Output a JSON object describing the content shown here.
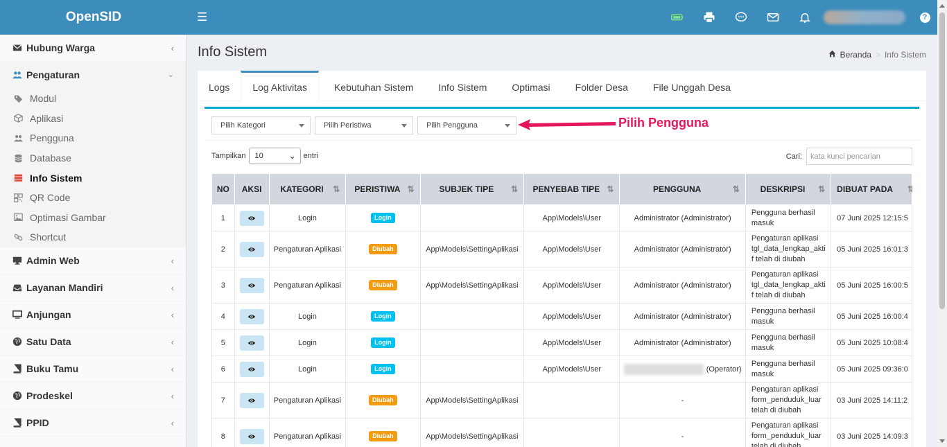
{
  "app": {
    "title": "OpenSID"
  },
  "header": {
    "icons": [
      "battery-icon",
      "print-icon",
      "chat-icon",
      "mail-icon",
      "bell-icon"
    ],
    "help_label": "?"
  },
  "sidebar": {
    "groups": [
      {
        "label": "Hubung Warga",
        "icon": "envelope-icon"
      },
      {
        "label": "Pengaturan",
        "icon": "users-icon"
      },
      {
        "label": "Admin Web",
        "icon": "desktop-icon"
      },
      {
        "label": "Layanan Mandiri",
        "icon": "inbox-icon"
      },
      {
        "label": "Anjungan",
        "icon": "monitor-icon"
      },
      {
        "label": "Satu Data",
        "icon": "globe-icon"
      },
      {
        "label": "Buku Tamu",
        "icon": "book-icon"
      },
      {
        "label": "Prodeskel",
        "icon": "globe-icon"
      },
      {
        "label": "PPID",
        "icon": "book-icon"
      }
    ],
    "submenu": [
      {
        "label": "Modul",
        "icon": "tags-icon"
      },
      {
        "label": "Aplikasi",
        "icon": "cube-icon"
      },
      {
        "label": "Pengguna",
        "icon": "users-icon"
      },
      {
        "label": "Database",
        "icon": "database-icon"
      },
      {
        "label": "Info Sistem",
        "icon": "server-icon"
      },
      {
        "label": "QR Code",
        "icon": "qrcode-icon"
      },
      {
        "label": "Optimasi Gambar",
        "icon": "image-icon"
      },
      {
        "label": "Shortcut",
        "icon": "link-icon"
      }
    ]
  },
  "page": {
    "title": "Info Sistem",
    "breadcrumb": {
      "home": "Beranda",
      "separator": ">",
      "current": "Info Sistem"
    }
  },
  "tabs": [
    "Logs",
    "Log Aktivitas",
    "Kebutuhan Sistem",
    "Info Sistem",
    "Optimasi",
    "Folder Desa",
    "File Unggah Desa"
  ],
  "filters": {
    "kategori": "Pilih Kategori",
    "peristiwa": "Pilih Peristiwa",
    "pengguna": "Pilih Pengguna"
  },
  "annotation": {
    "label": "Pilih Pengguna",
    "color": "#e4175c"
  },
  "table_controls": {
    "show_label": "Tampilkan",
    "show_value": "10",
    "entries_label": "entri",
    "search_label": "Cari:",
    "search_placeholder": "kata kunci pencarian"
  },
  "table": {
    "headers": [
      "NO",
      "AKSI",
      "KATEGORI",
      "PERISTIWA",
      "SUBJEK TIPE",
      "PENYEBAB TIPE",
      "PENGGUNA",
      "DESKRIPSI",
      "DIBUAT PADA"
    ],
    "sort_glyph": "⇅",
    "rows": [
      {
        "no": "1",
        "kategori": "Login",
        "peristiwa": "Login",
        "badge": "login",
        "subjek": "",
        "penyebab": "App\\Models\\User",
        "pengguna": "Administrator (Administrator)",
        "deskripsi": "Pengguna berhasil masuk",
        "dibuat": "07 Juni 2025 12:15:5"
      },
      {
        "no": "2",
        "kategori": "Pengaturan Aplikasi",
        "peristiwa": "Diubah",
        "badge": "diubah",
        "subjek": "App\\Models\\SettingAplikasi",
        "penyebab": "App\\Models\\User",
        "pengguna": "Administrator (Administrator)",
        "deskripsi": "Pengaturan aplikasi tgl_data_lengkap_aktif telah di diubah",
        "dibuat": "05 Juni 2025 16:01:3"
      },
      {
        "no": "3",
        "kategori": "Pengaturan Aplikasi",
        "peristiwa": "Diubah",
        "badge": "diubah",
        "subjek": "App\\Models\\SettingAplikasi",
        "penyebab": "App\\Models\\User",
        "pengguna": "Administrator (Administrator)",
        "deskripsi": "Pengaturan aplikasi tgl_data_lengkap_aktif telah di diubah",
        "dibuat": "05 Juni 2025 16:00:5"
      },
      {
        "no": "4",
        "kategori": "Login",
        "peristiwa": "Login",
        "badge": "login",
        "subjek": "",
        "penyebab": "App\\Models\\User",
        "pengguna": "Administrator (Administrator)",
        "deskripsi": "Pengguna berhasil masuk",
        "dibuat": "05 Juni 2025 16:00:4"
      },
      {
        "no": "5",
        "kategori": "Login",
        "peristiwa": "Login",
        "badge": "login",
        "subjek": "",
        "penyebab": "App\\Models\\User",
        "pengguna": "Administrator (Administrator)",
        "deskripsi": "Pengguna berhasil masuk",
        "dibuat": "05 Juni 2025 10:08:4"
      },
      {
        "no": "6",
        "kategori": "Login",
        "peristiwa": "Login",
        "badge": "login",
        "subjek": "",
        "penyebab": "App\\Models\\User",
        "pengguna": "(Operator)",
        "pengguna_blurred": true,
        "deskripsi": "Pengguna berhasil masuk",
        "dibuat": "05 Juni 2025 09:36:0"
      },
      {
        "no": "7",
        "kategori": "Pengaturan Aplikasi",
        "peristiwa": "Diubah",
        "badge": "diubah",
        "subjek": "App\\Models\\SettingAplikasi",
        "penyebab": "",
        "pengguna": "-",
        "deskripsi": "Pengaturan aplikasi form_penduduk_luar telah di diubah",
        "dibuat": "03 Juni 2025 14:11:2"
      },
      {
        "no": "8",
        "kategori": "Pengaturan Aplikasi",
        "peristiwa": "Diubah",
        "badge": "diubah",
        "subjek": "App\\Models\\SettingAplikasi",
        "penyebab": "",
        "pengguna": "-",
        "deskripsi": "Pengaturan aplikasi form_penduduk_luar telah di diubah",
        "dibuat": "03 Juni 2025 14:09:3"
      }
    ]
  }
}
